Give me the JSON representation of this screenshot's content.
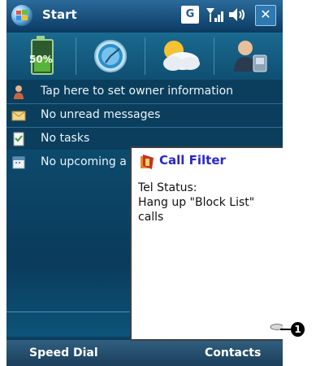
{
  "titlebar": {
    "title": "Start",
    "signal_badge": "G",
    "close_label": "✕"
  },
  "icon_strip": {
    "battery_text": "50%",
    "icons": [
      "battery-icon",
      "clock-icon",
      "weather-icon",
      "contacts-icon"
    ]
  },
  "today": {
    "items": [
      {
        "label": "Tap here to set owner information",
        "icon": "owner-icon"
      },
      {
        "label": "No unread messages",
        "icon": "messages-icon"
      },
      {
        "label": "No tasks",
        "icon": "tasks-icon"
      },
      {
        "label": "No upcoming a",
        "icon": "calendar-icon"
      }
    ]
  },
  "popup": {
    "title": "Call Filter",
    "line1": "Tel Status:",
    "line2": "Hang up \"Block List\"",
    "line3": "calls"
  },
  "softkeys": {
    "left": "Speed Dial",
    "right": "Contacts"
  },
  "callout": {
    "number": "1"
  }
}
